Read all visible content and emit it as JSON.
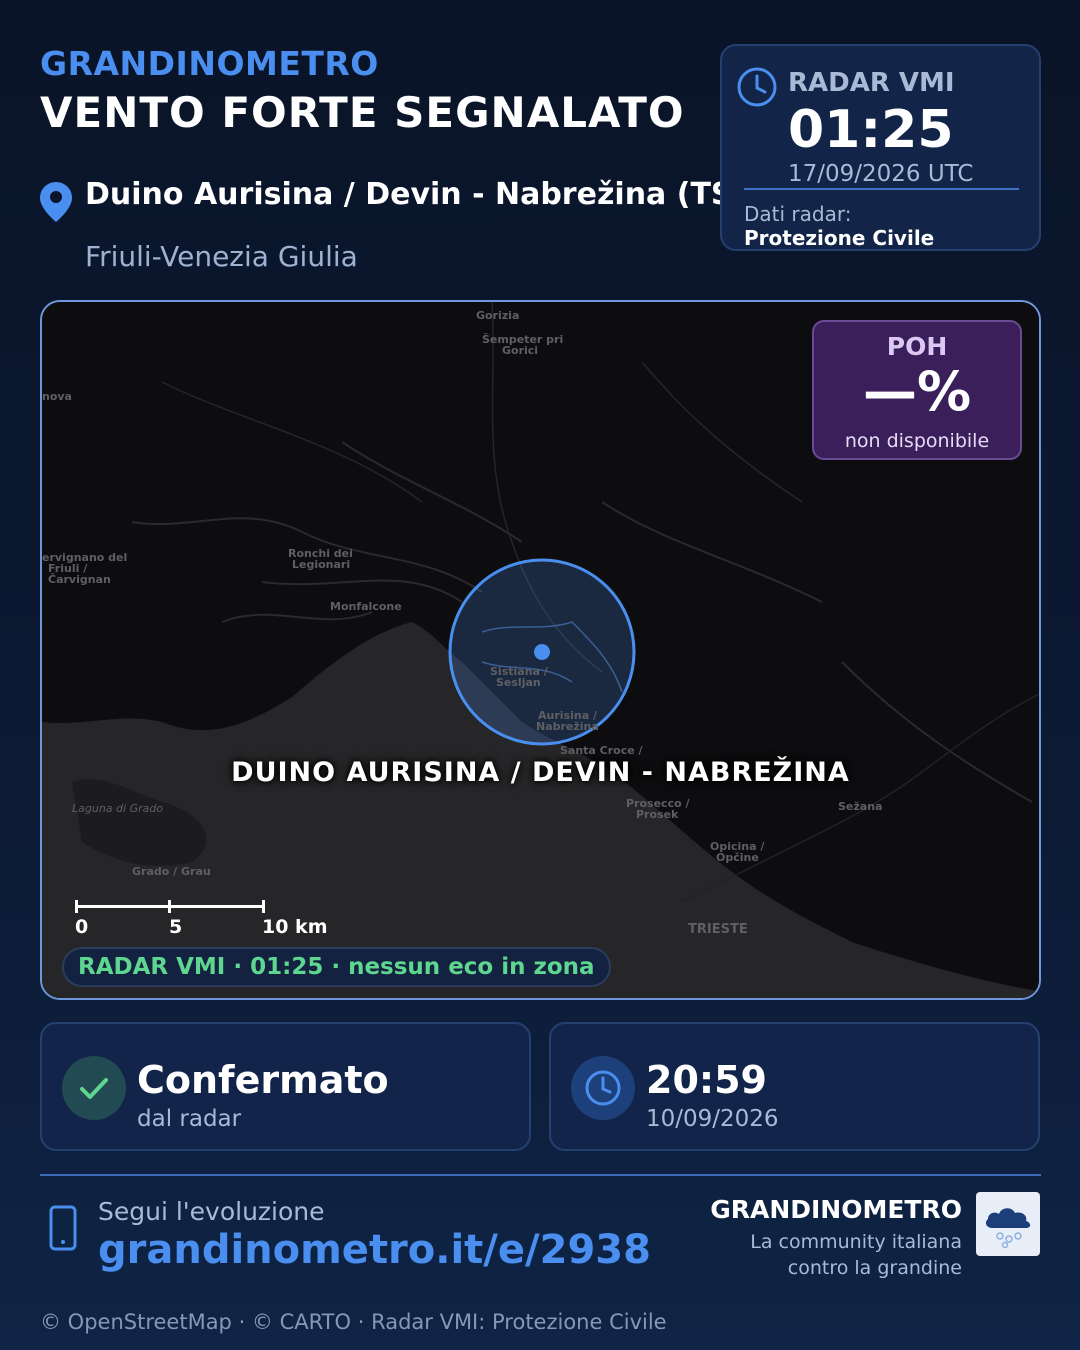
{
  "header": {
    "brand": "GRANDINOMETRO",
    "headline": "VENTO FORTE SEGNALATO",
    "location": "Duino Aurisina / Devin - Nabrežina (TS)",
    "region": "Friuli-Venezia Giulia",
    "pin_icon": "location-pin-icon"
  },
  "radar_card": {
    "label": "RADAR VMI",
    "time": "01:25",
    "date": "17/09/2026 UTC",
    "source_label": "Dati radar:",
    "source": "Protezione Civile",
    "icon": "clock-icon"
  },
  "map": {
    "city_label": "DUINO AURISINA / DEVIN - NABREŽINA",
    "places": {
      "gorizia": "Gorizia",
      "sempeter_1": "Šempeter pri",
      "sempeter_2": "Gorici",
      "nova": "nova",
      "cervignano_1": "ervignano del",
      "cervignano_2": "Friuli /",
      "cervignano_3": "Čarvignan",
      "ronchi_1": "Ronchi dei",
      "ronchi_2": "Legionari",
      "monfalcone": "Monfalcone",
      "sistiana_1": "Sistiana /",
      "sistiana_2": "Sesljan",
      "aurisina_1": "Aurisina /",
      "aurisina_2": "Nabrežina",
      "santa_croce": "Santa Croce /",
      "prosecco_1": "Prosecco /",
      "prosecco_2": "Prosek",
      "sezana": "Sežana",
      "opicina_1": "Opicina /",
      "opicina_2": "Opčine",
      "laguna": "Laguna di Grado",
      "grado": "Grado / Grau",
      "trieste": "TRIESTE"
    },
    "poh": {
      "label": "POH",
      "value": "—%",
      "note": "non disponibile"
    },
    "scale": {
      "tick_0": "0",
      "tick_5": "5",
      "tick_10": "10 km"
    },
    "radar_status": "RADAR VMI · 01:25 · nessun eco in zona",
    "colors": {
      "area_circle": "#4a8ff0",
      "sea": "#262628",
      "land": "#0d0d0f"
    }
  },
  "status_card": {
    "title": "Confermato",
    "subtitle": "dal radar",
    "icon": "checkmark-icon"
  },
  "time_card": {
    "time": "20:59",
    "date": "10/09/2026",
    "icon": "clock-icon"
  },
  "footer": {
    "follow_label": "Segui l'evoluzione",
    "url": "grandinometro.it/e/2938",
    "brand": "GRANDINOMETRO",
    "tagline": "La community italiana contro la grandine",
    "phone_icon": "smartphone-icon",
    "logo_icon": "hail-cloud-icon",
    "credits": "© OpenStreetMap · © CARTO · Radar VMI: Protezione Civile"
  },
  "theme": {
    "accent": "#4a8ff0",
    "background": "#0a1428",
    "card": "#12244a",
    "poh_card": "#3b1f5a",
    "success": "#5fd68f"
  }
}
